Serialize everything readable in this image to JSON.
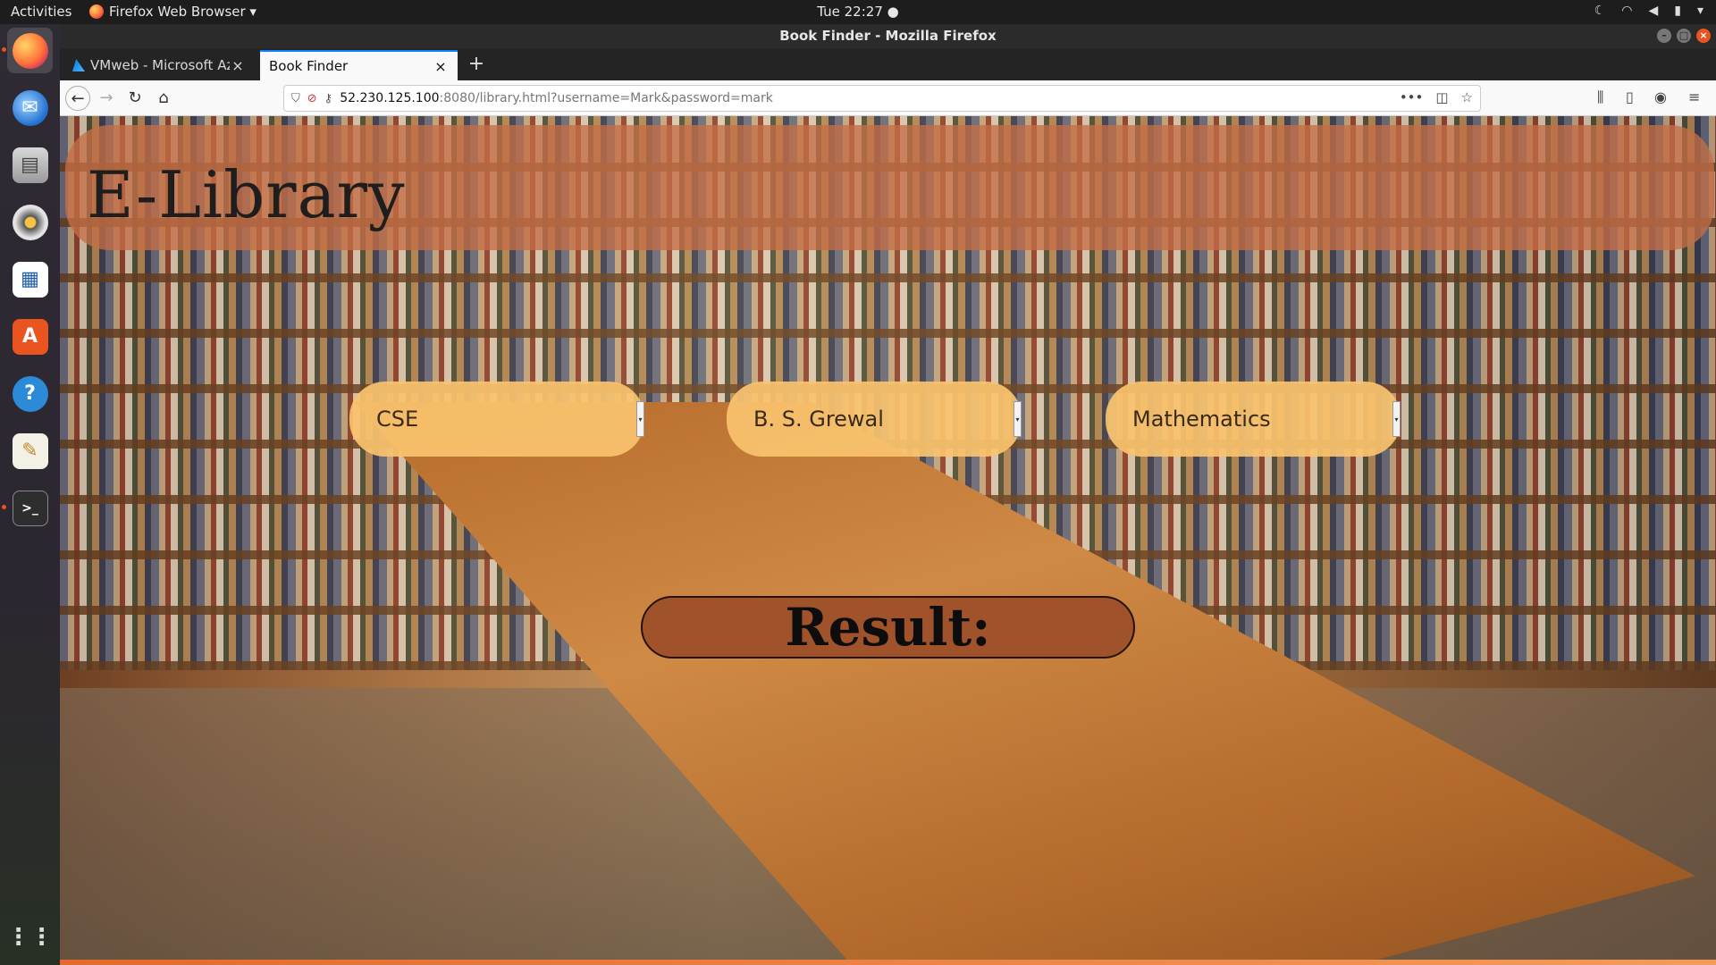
{
  "topbar": {
    "activities": "Activities",
    "app_menu": "Firefox Web Browser ▾",
    "clock": "Tue 22:27 ●"
  },
  "window": {
    "title": "Book Finder - Mozilla Firefox"
  },
  "tabs": [
    {
      "label": "VMweb - Microsoft Azure",
      "close": "×"
    },
    {
      "label": "Book Finder",
      "close": "×"
    }
  ],
  "newtab": "+",
  "urlbar": {
    "host": "52.230.125.100",
    "rest": ":8080/library.html?username=Mark&password=mark"
  },
  "page": {
    "heading": "E-Library",
    "dropdowns": [
      {
        "value": "CSE"
      },
      {
        "value": "B. S. Grewal"
      },
      {
        "value": "Mathematics"
      }
    ],
    "result_label": "Result:"
  },
  "dock": {
    "icons": [
      "firefox-icon",
      "thunderbird-icon",
      "files-icon",
      "rhythmbox-icon",
      "writer-icon",
      "software-icon",
      "help-icon",
      "text-editor-icon",
      "terminal-icon",
      "app-grid-icon"
    ]
  }
}
